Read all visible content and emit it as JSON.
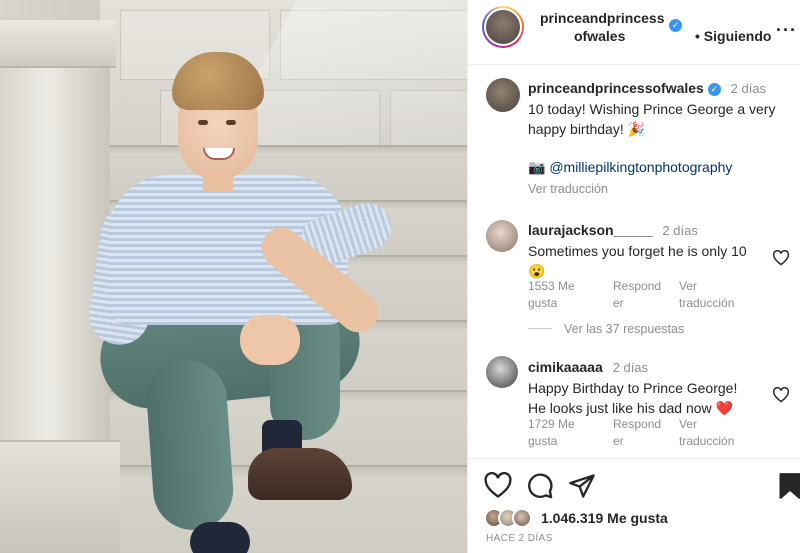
{
  "post": {
    "username": "princeandprincessofwales",
    "header_username_line1": "princeandprincess",
    "header_username_line2": "ofwales",
    "follow_label": "• Siguiendo",
    "more_label": "···",
    "caption_time": "2 días",
    "caption_line1": "10 today! Wishing Prince George a very",
    "caption_line2": "happy birthday! 🎉",
    "credit": "📷 @milliepilkingtonphotography",
    "translate_label": "Ver traducción"
  },
  "comments": [
    {
      "username": "laurajackson_____",
      "time": "2 días",
      "line1": "Sometimes you forget he is only 10",
      "line2": "😮",
      "likes_line1": "1553 Me",
      "likes_line2": "gusta",
      "reply_line1": "Respond",
      "reply_line2": "er",
      "translate_line1": "Ver",
      "translate_line2": "traducción",
      "replies_label": "Ver las 37 respuestas"
    },
    {
      "username": "cimikaaaaa",
      "time": "2 días",
      "line1": "Happy Birthday to Prince George!",
      "line2": "He looks just like his dad now ❤️",
      "likes_line1": "1729 Me",
      "likes_line2": "gusta",
      "reply_line1": "Respond",
      "reply_line2": "er",
      "translate_line1": "Ver",
      "translate_line2": "traducción"
    }
  ],
  "footer": {
    "likes": "1.046.319 Me gusta",
    "ago": "HACE 2 DÍAS"
  },
  "icons": [
    "heart-icon",
    "comment-icon",
    "share-icon",
    "bookmark-icon",
    "verified-icon",
    "more-icon"
  ],
  "colors": {
    "verified": "#3897f0",
    "heart_red": "#ed4956",
    "muted": "#8e8e8e",
    "text": "#262626"
  }
}
